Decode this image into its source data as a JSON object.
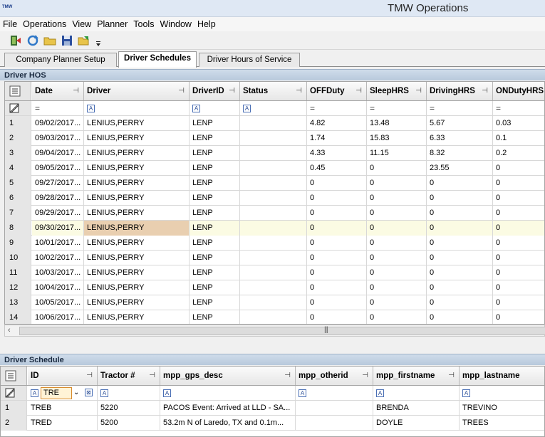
{
  "window": {
    "title": "TMW Operations",
    "logo": "TMW"
  },
  "menu": [
    "File",
    "Operations",
    "View",
    "Planner",
    "Tools",
    "Window",
    "Help"
  ],
  "toolbar": {
    "buttons": [
      "exit-icon",
      "refresh-icon",
      "open-folder-icon",
      "save-icon",
      "export-icon",
      "overflow-icon"
    ]
  },
  "tabs": [
    "Company Planner Setup",
    "Driver Schedules",
    "Driver Hours of Service"
  ],
  "active_tab": "Driver Schedules",
  "hos": {
    "title": "Driver HOS",
    "columns": [
      "Date",
      "Driver",
      "DriverID",
      "Status",
      "OFFDuty",
      "SleepHRS",
      "DrivingHRS",
      "ONDutyHRS"
    ],
    "rows": [
      {
        "n": "1",
        "date": "09/02/2017...",
        "driver": "LENIUS,PERRY",
        "id": "LENP",
        "status": "",
        "off": "4.82",
        "sleep": "13.48",
        "drive": "5.67",
        "on": "0.03"
      },
      {
        "n": "2",
        "date": "09/03/2017...",
        "driver": "LENIUS,PERRY",
        "id": "LENP",
        "status": "",
        "off": "1.74",
        "sleep": "15.83",
        "drive": "6.33",
        "on": "0.1"
      },
      {
        "n": "3",
        "date": "09/04/2017...",
        "driver": "LENIUS,PERRY",
        "id": "LENP",
        "status": "",
        "off": "4.33",
        "sleep": "11.15",
        "drive": "8.32",
        "on": "0.2"
      },
      {
        "n": "4",
        "date": "09/05/2017...",
        "driver": "LENIUS,PERRY",
        "id": "LENP",
        "status": "",
        "off": "0.45",
        "sleep": "0",
        "drive": "23.55",
        "on": "0"
      },
      {
        "n": "5",
        "date": "09/27/2017...",
        "driver": "LENIUS,PERRY",
        "id": "LENP",
        "status": "",
        "off": "0",
        "sleep": "0",
        "drive": "0",
        "on": "0"
      },
      {
        "n": "6",
        "date": "09/28/2017...",
        "driver": "LENIUS,PERRY",
        "id": "LENP",
        "status": "",
        "off": "0",
        "sleep": "0",
        "drive": "0",
        "on": "0"
      },
      {
        "n": "7",
        "date": "09/29/2017...",
        "driver": "LENIUS,PERRY",
        "id": "LENP",
        "status": "",
        "off": "0",
        "sleep": "0",
        "drive": "0",
        "on": "0"
      },
      {
        "n": "8",
        "date": "09/30/2017...",
        "driver": "LENIUS,PERRY",
        "id": "LENP",
        "status": "",
        "off": "0",
        "sleep": "0",
        "drive": "0",
        "on": "0"
      },
      {
        "n": "9",
        "date": "10/01/2017...",
        "driver": "LENIUS,PERRY",
        "id": "LENP",
        "status": "",
        "off": "0",
        "sleep": "0",
        "drive": "0",
        "on": "0"
      },
      {
        "n": "10",
        "date": "10/02/2017...",
        "driver": "LENIUS,PERRY",
        "id": "LENP",
        "status": "",
        "off": "0",
        "sleep": "0",
        "drive": "0",
        "on": "0"
      },
      {
        "n": "11",
        "date": "10/03/2017...",
        "driver": "LENIUS,PERRY",
        "id": "LENP",
        "status": "",
        "off": "0",
        "sleep": "0",
        "drive": "0",
        "on": "0"
      },
      {
        "n": "12",
        "date": "10/04/2017...",
        "driver": "LENIUS,PERRY",
        "id": "LENP",
        "status": "",
        "off": "0",
        "sleep": "0",
        "drive": "0",
        "on": "0"
      },
      {
        "n": "13",
        "date": "10/05/2017...",
        "driver": "LENIUS,PERRY",
        "id": "LENP",
        "status": "",
        "off": "0",
        "sleep": "0",
        "drive": "0",
        "on": "0"
      },
      {
        "n": "14",
        "date": "10/06/2017...",
        "driver": "LENIUS,PERRY",
        "id": "LENP",
        "status": "",
        "off": "0",
        "sleep": "0",
        "drive": "0",
        "on": "0"
      }
    ],
    "selected_row": "8"
  },
  "schedule": {
    "title": "Driver Schedule",
    "columns": [
      "ID",
      "Tractor #",
      "mpp_gps_desc",
      "mpp_otherid",
      "mpp_firstname",
      "mpp_lastname"
    ],
    "filter_value": "TRE",
    "rows": [
      {
        "n": "1",
        "id": "TREB",
        "tractor": "5220",
        "gps": "PACOS Event: Arrived at LLD - SA...",
        "other": "",
        "first": "BRENDA",
        "last": "TREVINO"
      },
      {
        "n": "2",
        "id": "TRED",
        "tractor": "5200",
        "gps": "53.2m N of Laredo, TX and 0.1m...",
        "other": "",
        "first": "DOYLE",
        "last": "TREES"
      }
    ]
  }
}
